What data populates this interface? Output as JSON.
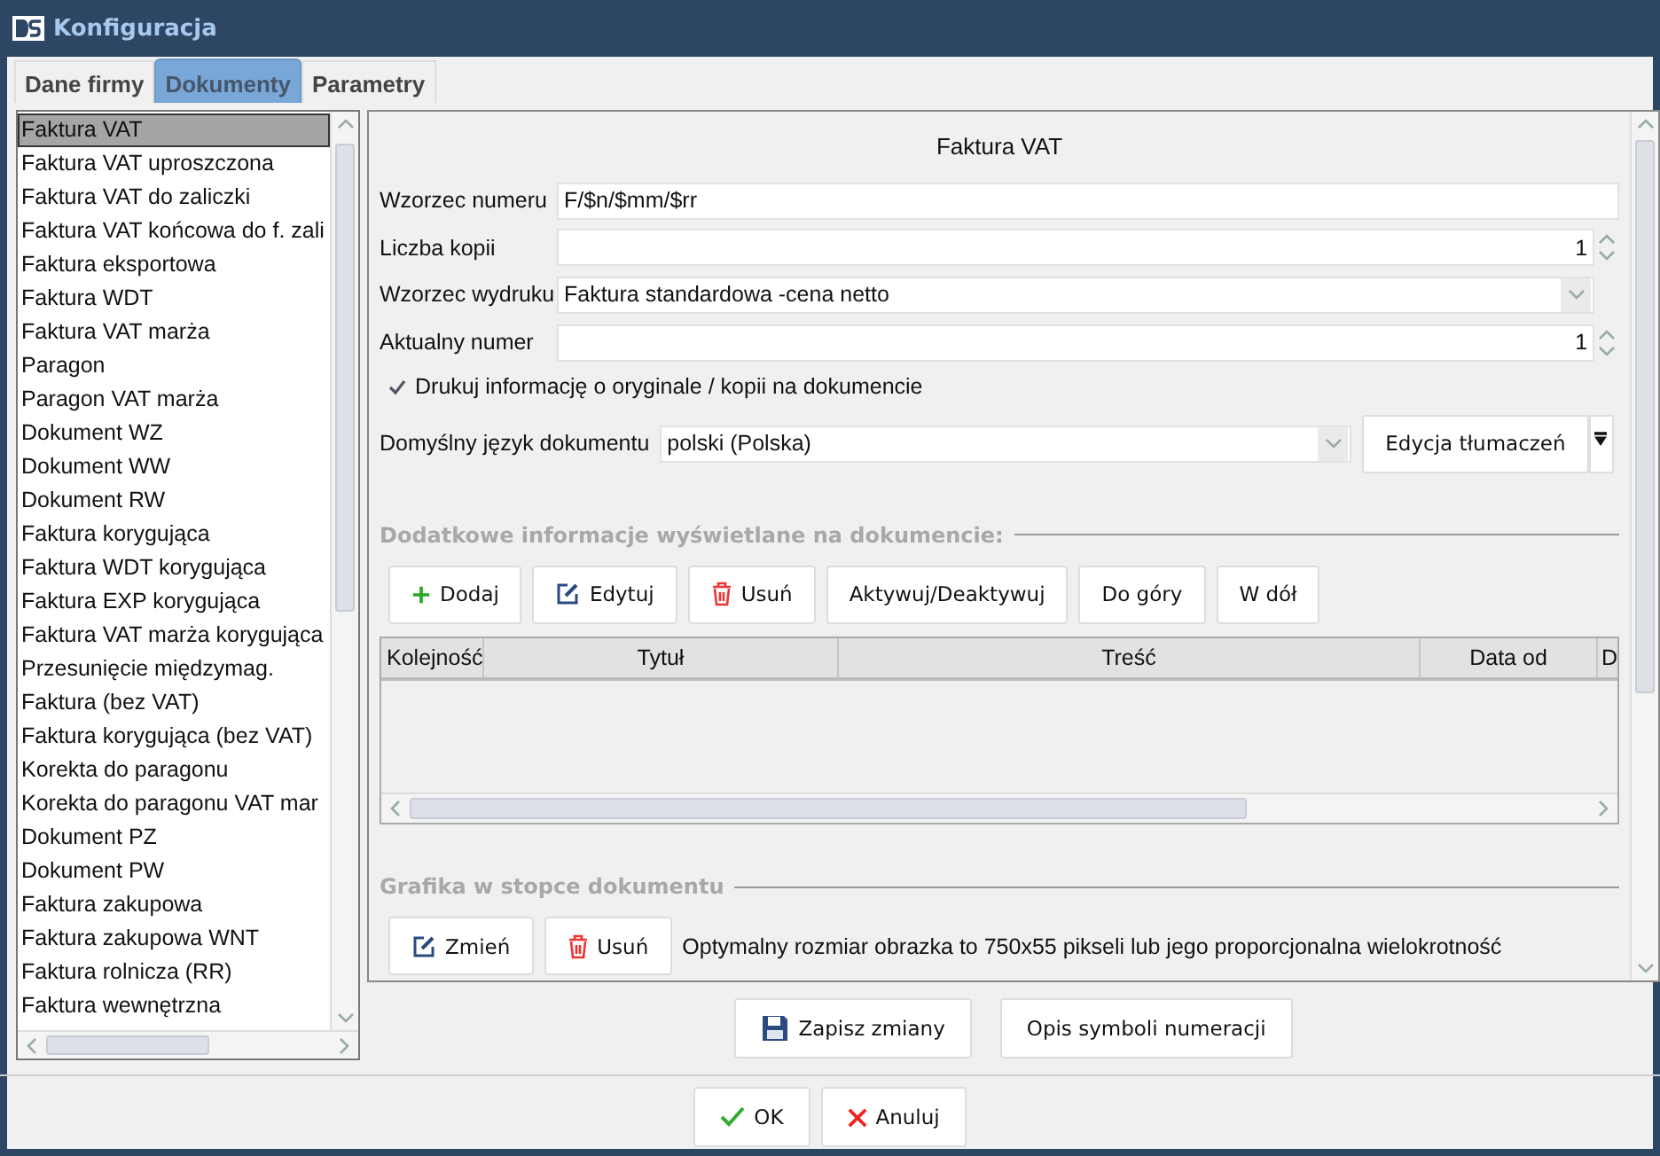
{
  "window": {
    "title": "Konfiguracja"
  },
  "tabs": [
    {
      "label": "Dane firmy",
      "selected": false
    },
    {
      "label": "Dokumenty",
      "selected": true
    },
    {
      "label": "Parametry",
      "selected": false
    }
  ],
  "document_list": {
    "items": [
      {
        "label": "Faktura VAT",
        "selected": true
      },
      {
        "label": "Faktura VAT uproszczona",
        "selected": false
      },
      {
        "label": "Faktura VAT do zaliczki",
        "selected": false
      },
      {
        "label": "Faktura VAT końcowa do f. zali",
        "selected": false
      },
      {
        "label": "Faktura eksportowa",
        "selected": false
      },
      {
        "label": "Faktura WDT",
        "selected": false
      },
      {
        "label": "Faktura VAT marża",
        "selected": false
      },
      {
        "label": "Paragon",
        "selected": false
      },
      {
        "label": "Paragon VAT marża",
        "selected": false
      },
      {
        "label": "Dokument WZ",
        "selected": false
      },
      {
        "label": "Dokument WW",
        "selected": false
      },
      {
        "label": "Dokument RW",
        "selected": false
      },
      {
        "label": "Faktura korygująca",
        "selected": false
      },
      {
        "label": "Faktura WDT korygująca",
        "selected": false
      },
      {
        "label": "Faktura EXP korygująca",
        "selected": false
      },
      {
        "label": "Faktura VAT marża korygująca",
        "selected": false
      },
      {
        "label": "Przesunięcie międzymag.",
        "selected": false
      },
      {
        "label": "Faktura (bez VAT)",
        "selected": false
      },
      {
        "label": "Faktura korygująca (bez VAT)",
        "selected": false
      },
      {
        "label": "Korekta do paragonu",
        "selected": false
      },
      {
        "label": "Korekta do paragonu VAT mar",
        "selected": false
      },
      {
        "label": "Dokument PZ",
        "selected": false
      },
      {
        "label": "Dokument PW",
        "selected": false
      },
      {
        "label": "Faktura zakupowa",
        "selected": false
      },
      {
        "label": "Faktura zakupowa WNT",
        "selected": false
      },
      {
        "label": "Faktura rolnicza (RR)",
        "selected": false
      },
      {
        "label": "Faktura wewnętrzna",
        "selected": false
      }
    ]
  },
  "form": {
    "heading": "Faktura VAT",
    "fields": [
      {
        "kind": "text",
        "label": "Wzorzec numeru",
        "value": "F/$n/$mm/$rr"
      },
      {
        "kind": "spinner",
        "label": "Liczba kopii",
        "value": "1"
      },
      {
        "kind": "dropdown",
        "label": "Wzorzec wydruku",
        "value": "Faktura standardowa -cena netto"
      },
      {
        "kind": "spinner",
        "label": "Aktualny numer",
        "value": "1"
      }
    ],
    "print_info_checkbox": {
      "label": "Drukuj informację o oryginale / kopii na dokumencie",
      "checked": true
    },
    "language": {
      "label": "Domyślny język dokumentu",
      "value": "polski (Polska)",
      "button": "Edycja tłumaczeń"
    }
  },
  "extra_info": {
    "title": "Dodatkowe informacje wyświetlane na dokumencie:",
    "buttons": [
      {
        "kind": "add",
        "label": "Dodaj"
      },
      {
        "kind": "edit",
        "label": "Edytuj"
      },
      {
        "kind": "delete",
        "label": "Usuń"
      },
      {
        "kind": "plain",
        "label": "Aktywuj/Deaktywuj"
      },
      {
        "kind": "plain",
        "label": "Do góry"
      },
      {
        "kind": "plain",
        "label": "W dół"
      }
    ],
    "table": {
      "columns": [
        "Kolejność",
        "Tytuł",
        "Treść",
        "Data od",
        "D"
      ]
    }
  },
  "footer_graphic": {
    "title": "Grafika w stopce dokumentu",
    "buttons": [
      {
        "kind": "edit",
        "label": "Zmień"
      },
      {
        "kind": "delete",
        "label": "Usuń"
      }
    ],
    "hint": "Optymalny rozmiar obrazka to 750x55 pikseli lub jego proporcjonalna wielokrotność"
  },
  "actions": [
    {
      "kind": "save",
      "label": "Zapisz zmiany"
    },
    {
      "kind": "plain",
      "label": "Opis symboli numeracji"
    }
  ],
  "dialog_buttons": [
    {
      "kind": "ok",
      "label": "OK"
    },
    {
      "kind": "cancel",
      "label": "Anuluj"
    }
  ]
}
